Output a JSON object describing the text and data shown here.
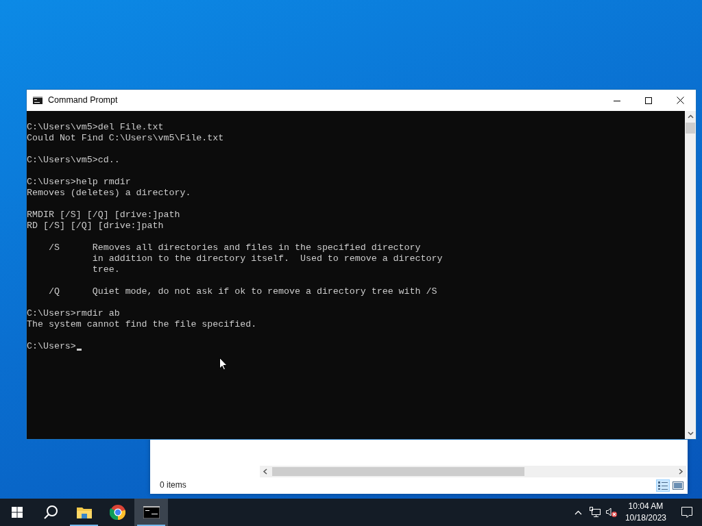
{
  "background_window": {
    "status": "0 items",
    "view_buttons": [
      {
        "kind": "details",
        "selected": true
      },
      {
        "kind": "large_icons",
        "selected": false
      }
    ]
  },
  "console_window": {
    "title": "Command Prompt",
    "output_blocks": [
      [
        "C:\\Users\\vm5>del File.txt",
        "Could Not Find C:\\Users\\vm5\\File.txt"
      ],
      [
        "C:\\Users\\vm5>cd.."
      ],
      [
        "C:\\Users>help rmdir",
        "Removes (deletes) a directory."
      ],
      [
        "RMDIR [/S] [/Q] [drive:]path",
        "RD [/S] [/Q] [drive:]path"
      ],
      [
        "    /S      Removes all directories and files in the specified directory",
        "            in addition to the directory itself.  Used to remove a directory",
        "            tree."
      ],
      [
        "    /Q      Quiet mode, do not ask if ok to remove a directory tree with /S"
      ],
      [
        "C:\\Users>rmdir ab",
        "The system cannot find the file specified."
      ]
    ],
    "prompt": "C:\\Users>"
  },
  "taskbar": {
    "items": [
      {
        "kind": "start",
        "running": false,
        "active": false
      },
      {
        "kind": "search",
        "running": false,
        "active": false
      },
      {
        "kind": "explorer",
        "running": true,
        "active": false
      },
      {
        "kind": "chrome",
        "running": false,
        "active": false
      },
      {
        "kind": "cmd",
        "running": true,
        "active": true
      }
    ],
    "tray": {
      "volume_muted": true,
      "time": "10:04 AM",
      "date": "10/18/2023"
    }
  }
}
